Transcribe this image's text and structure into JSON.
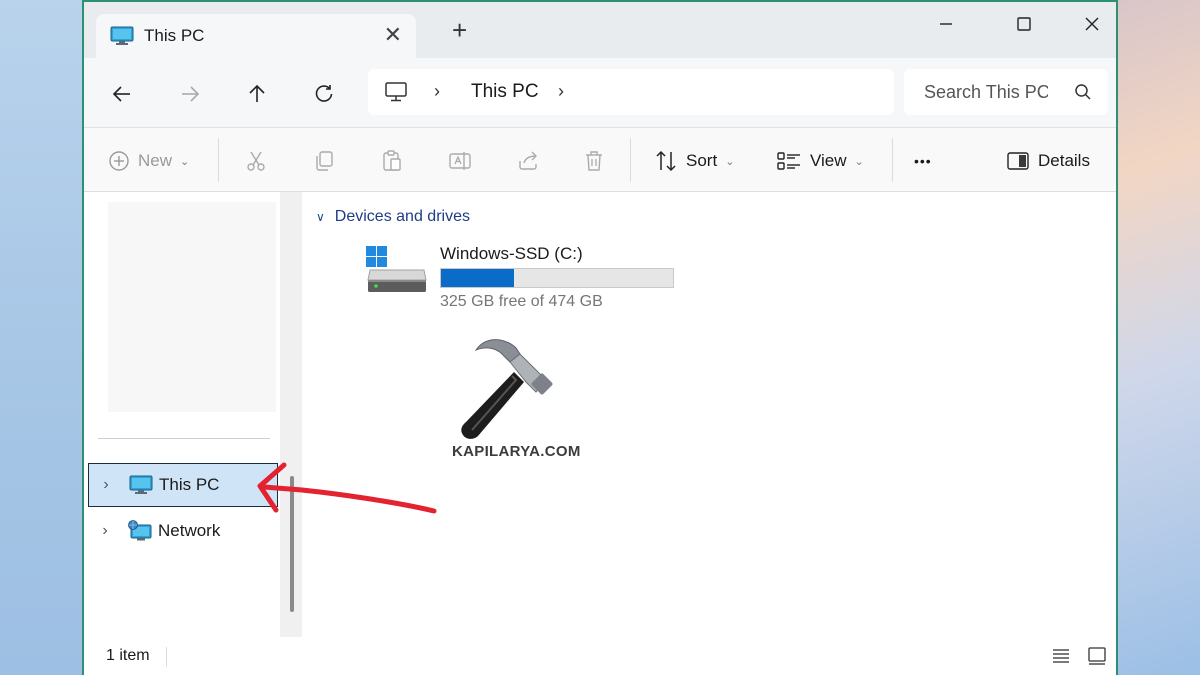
{
  "window": {
    "tab_title": "This PC",
    "tab_close": "✕",
    "new_tab": "+"
  },
  "address_bar": {
    "location": "This PC",
    "separator": "›"
  },
  "search": {
    "placeholder": "Search This PC"
  },
  "command_bar": {
    "new_label": "New",
    "sort_label": "Sort",
    "view_label": "View",
    "more_label": "•••",
    "details_label": "Details"
  },
  "sidebar": {
    "items": [
      {
        "label": "This PC",
        "selected": true
      },
      {
        "label": "Network",
        "selected": false
      }
    ]
  },
  "main": {
    "group_title": "Devices and drives",
    "drive": {
      "name": "Windows-SSD (C:)",
      "free_text": "325 GB free of 474 GB",
      "free_gb": 325,
      "total_gb": 474,
      "used_fraction": 0.314
    }
  },
  "watermark": {
    "text": "KAPILARYA.COM"
  },
  "status_bar": {
    "item_count": "1 item"
  },
  "colors": {
    "accent": "#0b6bc9",
    "selection": "#cfe4f7",
    "annotation_arrow": "#e3232f",
    "window_border": "#2f8f73"
  }
}
